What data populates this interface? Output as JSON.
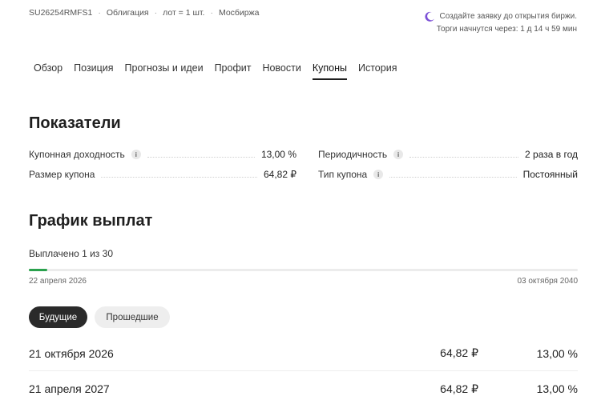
{
  "instrument": {
    "ticker": "SU26254RMFS1",
    "type": "Облигация",
    "lot": "лот = 1 шт.",
    "exchange": "Мосбиржа"
  },
  "notice": {
    "line1": "Создайте заявку до открытия биржи.",
    "line2": "Торги начнутся через: 1 д 14 ч 59 мин",
    "icon": "moon-icon",
    "icon_color": "#7b4fd6"
  },
  "tabs": [
    {
      "label": "Обзор"
    },
    {
      "label": "Позиция"
    },
    {
      "label": "Прогнозы и идеи"
    },
    {
      "label": "Профит"
    },
    {
      "label": "Новости"
    },
    {
      "label": "Купоны",
      "active": true
    },
    {
      "label": "История"
    }
  ],
  "indicators": {
    "title": "Показатели",
    "coupon_yield": {
      "label": "Купонная доходность",
      "value": "13,00 %"
    },
    "coupon_size": {
      "label": "Размер купона",
      "value": "64,82 ₽"
    },
    "frequency": {
      "label": "Периодичность",
      "value": "2 раза в год"
    },
    "coupon_type": {
      "label": "Тип купона",
      "value": "Постоянный"
    }
  },
  "schedule": {
    "title": "График выплат",
    "paid_text": "Выплачено 1 из 30",
    "paid": 1,
    "total": 30,
    "progress_color": "#2aa14d",
    "start_date": "22 апреля 2026",
    "end_date": "03 октября 2040",
    "filters": {
      "future": "Будущие",
      "past": "Прошедшие",
      "selected": "future"
    },
    "payments": [
      {
        "date": "21 октября 2026",
        "amount": "64,82 ₽",
        "percent": "13,00 %"
      },
      {
        "date": "21 апреля 2027",
        "amount": "64,82 ₽",
        "percent": "13,00 %"
      }
    ]
  }
}
